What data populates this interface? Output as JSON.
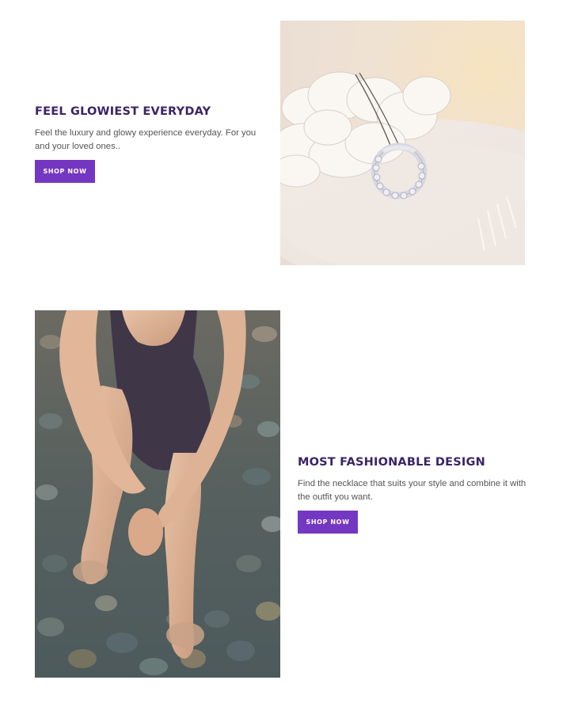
{
  "section1": {
    "heading": "FEEL GLOWIEST EVERYDAY",
    "description": "Feel the luxury and glowy experience everyday. For you and your loved ones..",
    "button_label": "SHOP NOW"
  },
  "section2": {
    "heading": "MOST FASHIONABLE DESIGN",
    "description": "Find the necklace that suits your style and combine it with the outfit you want.",
    "button_label": "SHOP NOW"
  },
  "colors": {
    "accent": "#7437c2",
    "heading": "#3b2466"
  }
}
